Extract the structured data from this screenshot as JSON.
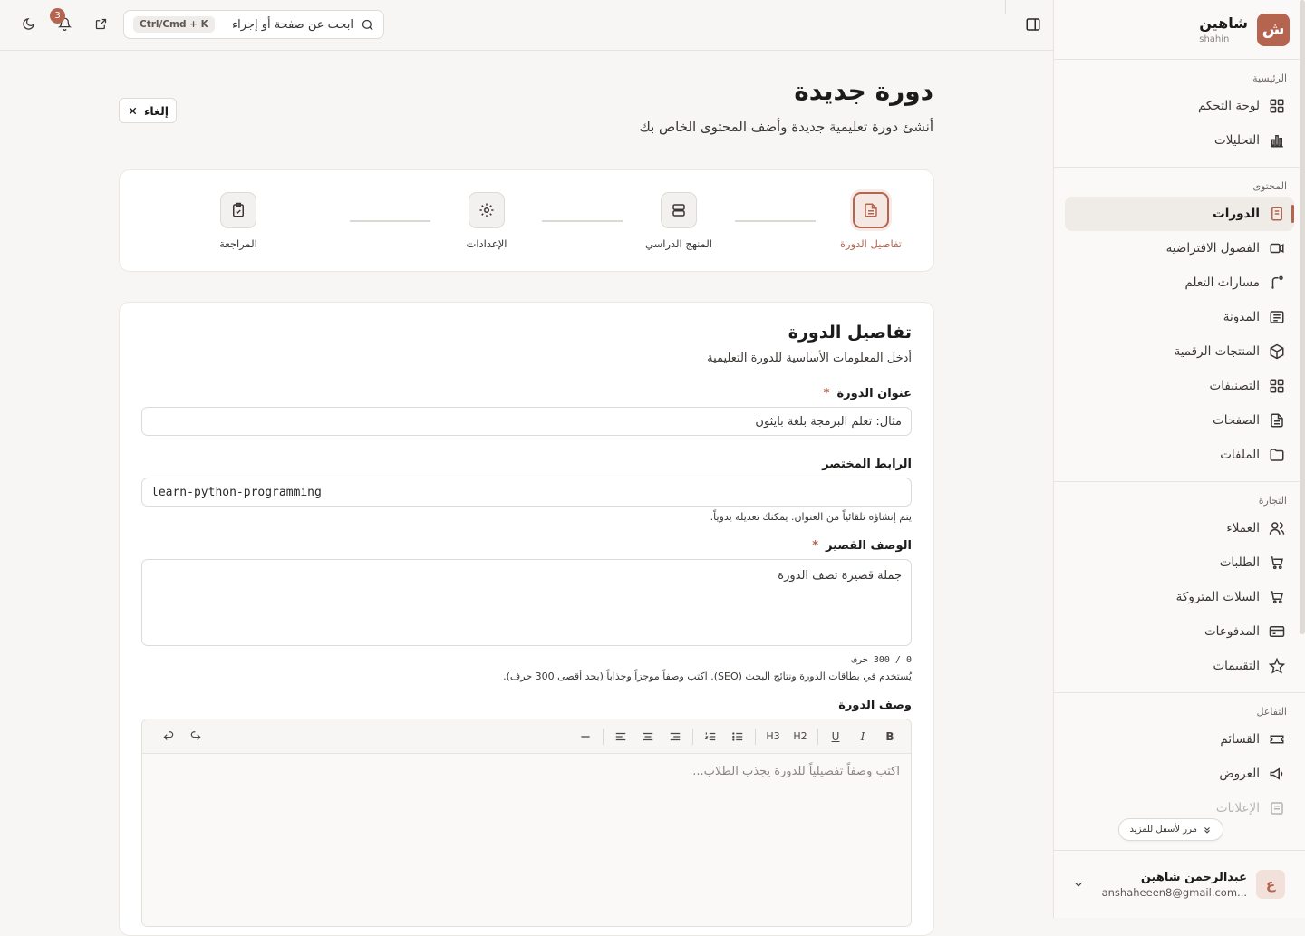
{
  "brand": {
    "logo_letter": "ش",
    "name": "شاهين",
    "sub": "shahin",
    "color": "#b5654f"
  },
  "sidebar": {
    "sections": [
      {
        "title": "الرئيسية",
        "items": [
          {
            "label": "لوحة التحكم",
            "icon": "dashboard-icon"
          },
          {
            "label": "التحليلات",
            "icon": "chart-icon"
          }
        ]
      },
      {
        "title": "المحتوى",
        "items": [
          {
            "label": "الدورات",
            "icon": "book-icon",
            "active": true
          },
          {
            "label": "الفصول الافتراضية",
            "icon": "video-icon"
          },
          {
            "label": "مسارات التعلم",
            "icon": "route-icon"
          },
          {
            "label": "المدونة",
            "icon": "newspaper-icon"
          },
          {
            "label": "المنتجات الرقمية",
            "icon": "package-icon"
          },
          {
            "label": "التصنيفات",
            "icon": "grid-icon"
          },
          {
            "label": "الصفحات",
            "icon": "file-icon"
          },
          {
            "label": "الملفات",
            "icon": "folder-icon"
          }
        ]
      },
      {
        "title": "التجارة",
        "items": [
          {
            "label": "العملاء",
            "icon": "users-icon"
          },
          {
            "label": "الطلبات",
            "icon": "cart-icon"
          },
          {
            "label": "السلات المتروكة",
            "icon": "cart-icon"
          },
          {
            "label": "المدفوعات",
            "icon": "credit-card-icon"
          },
          {
            "label": "التقييمات",
            "icon": "star-icon"
          }
        ]
      },
      {
        "title": "التفاعل",
        "items": [
          {
            "label": "القسائم",
            "icon": "ticket-icon"
          },
          {
            "label": "العروض",
            "icon": "megaphone-icon"
          },
          {
            "label": "الإعلانات",
            "icon": "ad-icon",
            "faded": true
          }
        ]
      }
    ],
    "scroll_more": "مرر لأسفل للمزيد"
  },
  "user": {
    "initial": "ع",
    "name": "عبدالرحمن شاهين",
    "email": "anshaheeen8@gmail.com..."
  },
  "topbar": {
    "search_placeholder": "ابحث عن صفحة أو إجراء",
    "shortcut": "Ctrl/Cmd + K",
    "notifications": "3"
  },
  "page": {
    "title": "دورة جديدة",
    "subtitle": "أنشئ دورة تعليمية جديدة وأضف المحتوى الخاص بك",
    "cancel": "إلغاء"
  },
  "steps": [
    {
      "label": "تفاصيل الدورة",
      "icon": "document-icon",
      "active": true
    },
    {
      "label": "المنهج الدراسي",
      "icon": "layers-icon"
    },
    {
      "label": "الإعدادات",
      "icon": "gear-icon"
    },
    {
      "label": "المراجعة",
      "icon": "clipboard-check-icon"
    }
  ],
  "form": {
    "title": "تفاصيل الدورة",
    "subtitle": "أدخل المعلومات الأساسية للدورة التعليمية",
    "title_label": "عنوان الدورة",
    "title_placeholder": "مثال: تعلم البرمجة بلغة بايثون",
    "required_mark": "*",
    "slug_label": "الرابط المختصر",
    "slug_value": "learn-python-programming",
    "slug_help": "يتم إنشاؤه تلقائياً من العنوان. يمكنك تعديله يدوياً.",
    "short_label": "الوصف القصير",
    "short_placeholder": "جملة قصيرة تصف الدورة",
    "counter": "0 / 300 حرف",
    "short_help": "يُستخدم في بطاقات الدورة ونتائج البحث (SEO). اكتب وصفاً موجزاً وجذاباً (بحد أقصى 300 حرف).",
    "desc_label": "وصف الدورة",
    "desc_placeholder": "اكتب وصفاً تفصيلياً للدورة يجذب الطلاب..."
  },
  "toolbar": {
    "bold": "B",
    "italic": "I",
    "underline": "U",
    "h2": "H2",
    "h3": "H3"
  }
}
